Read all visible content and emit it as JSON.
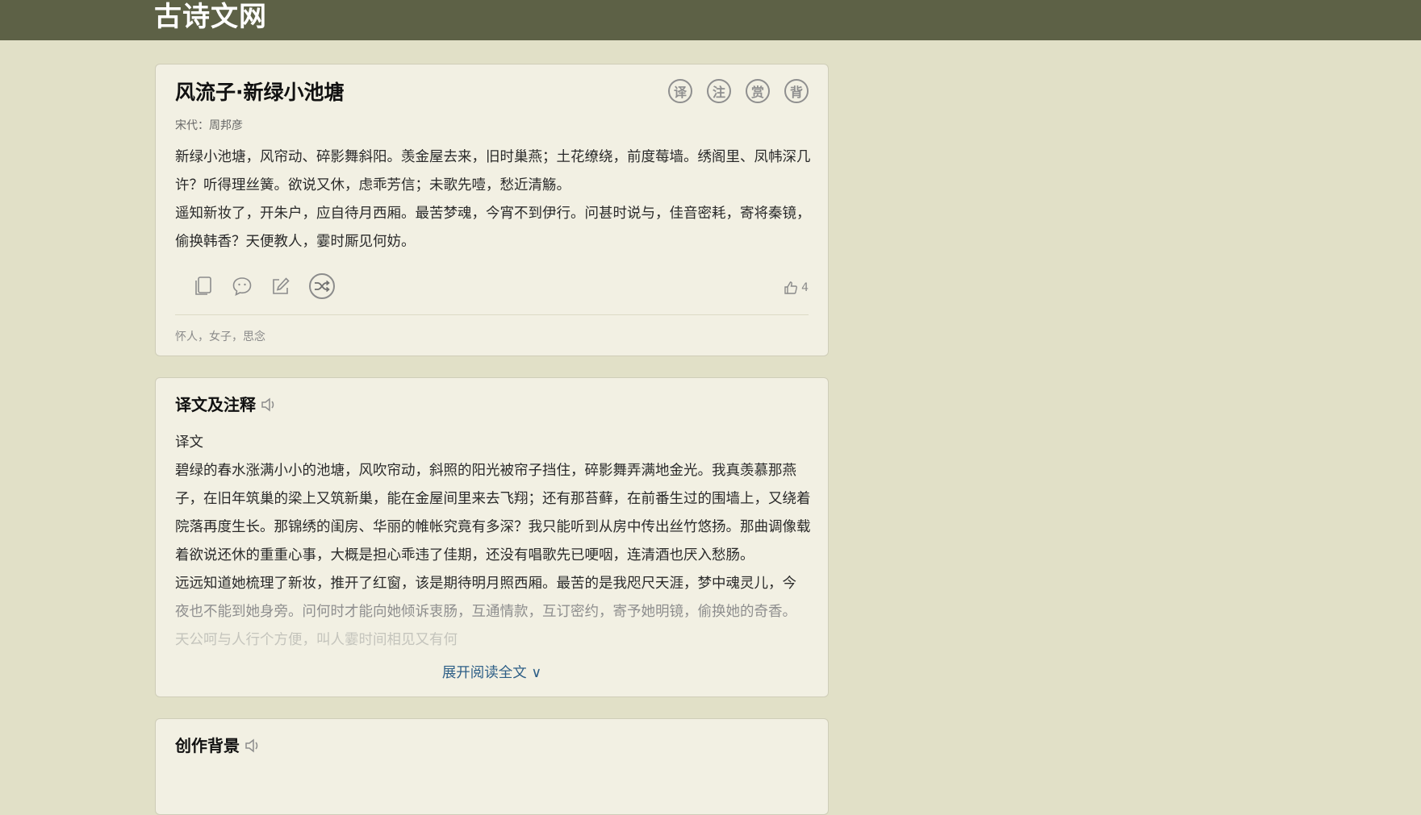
{
  "site": {
    "logo": "古诗文网"
  },
  "poem": {
    "title": "风流子·新绿小池塘",
    "source": "宋代：周邦彦",
    "lines": [
      "新绿小池塘，风帘动、碎影舞斜阳。羡金屋去来，旧时巢燕；土花缭绕，前度莓墙。绣阁里、凤帏深几许？听得理丝簧。欲说又休，虑乖芳信；未歌先噎，愁近清觞。",
      "遥知新妆了，开朱户，应自待月西厢。最苦梦魂，今宵不到伊行。问甚时说与，佳音密耗，寄将秦镜，偷换韩香？天便教人，霎时厮见何妨。"
    ],
    "top_icons": [
      "译",
      "注",
      "赏",
      "背"
    ],
    "tools": [
      "copy-icon",
      "comment-icon",
      "edit-icon",
      "shuffle-icon"
    ],
    "like_count": "4",
    "tags": "怀人，女子，思念"
  },
  "translation": {
    "title": "译文及注释",
    "label": "译文",
    "para1": "碧绿的春水涨满小小的池塘，风吹帘动，斜照的阳光被帘子挡住，碎影舞弄满地金光。我真羡慕那燕子，在旧年筑巢的梁上又筑新巢，能在金屋间里来去飞翔；还有那苔藓，在前番生过的围墙上，又绕着院落再度生长。那锦绣的闺房、华丽的帷帐究竟有多深？我只能听到从房中传出丝竹悠扬。那曲调像载着欲说还休的重重心事，大概是担心乖违了佳期，还没有唱歌先已哽咽，连清酒也厌入愁肠。",
    "para2_a": "远远知道她梳理了新妆，推开了红窗，该是期待明月照西厢。最苦的是我咫尺天涯，梦中魂灵儿，今",
    "para2_b": "夜也不能到她身旁。问何时才能向她倾诉衷肠，互通情款，互订密约，寄予她明镜，偷换她的奇香。",
    "para2_c": "天公呵与人行个方便，叫人霎时间相见又有何",
    "expand": "展开阅读全文 ∨"
  },
  "background_section": {
    "title": "创作背景"
  }
}
